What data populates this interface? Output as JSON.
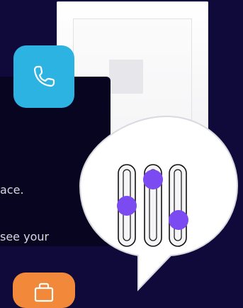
{
  "card": {
    "line1": "ace.",
    "line2": "see your"
  },
  "icons": {
    "phone": "phone-icon",
    "toolbox": "toolbox-icon",
    "sliders": "sliders-icon"
  },
  "colors": {
    "background": "#0f0a3a",
    "card": "#070520",
    "phone_tile": "#2db3e2",
    "orange_tile": "#f2893a",
    "slider_knob": "#7b4af0"
  }
}
